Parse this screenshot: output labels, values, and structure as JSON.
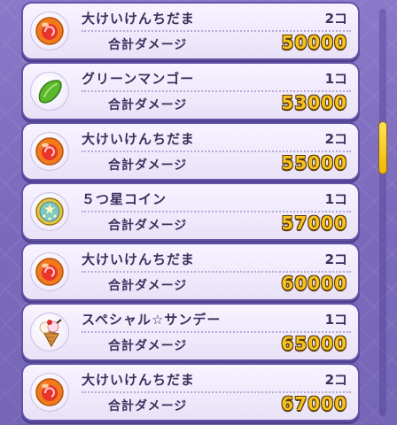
{
  "list": {
    "rows": [
      {
        "name": "大けいけんちだま",
        "qty": "2コ",
        "damage_label": "合計ダメージ",
        "damage": "50000",
        "icon": "exp-orb-icon"
      },
      {
        "name": "グリーンマンゴー",
        "qty": "1コ",
        "damage_label": "合計ダメージ",
        "damage": "53000",
        "icon": "green-mango-icon"
      },
      {
        "name": "大けいけんちだま",
        "qty": "2コ",
        "damage_label": "合計ダメージ",
        "damage": "55000",
        "icon": "exp-orb-icon"
      },
      {
        "name": "５つ星コイン",
        "qty": "1コ",
        "damage_label": "合計ダメージ",
        "damage": "57000",
        "icon": "five-star-coin-icon"
      },
      {
        "name": "大けいけんちだま",
        "qty": "2コ",
        "damage_label": "合計ダメージ",
        "damage": "60000",
        "icon": "exp-orb-icon"
      },
      {
        "name": "スペシャル☆サンデー",
        "qty": "1コ",
        "damage_label": "合計ダメージ",
        "damage": "65000",
        "icon": "special-sundae-icon"
      },
      {
        "name": "大けいけんちだま",
        "qty": "2コ",
        "damage_label": "合計ダメージ",
        "damage": "67000",
        "icon": "exp-orb-icon"
      }
    ]
  },
  "colors": {
    "background": "#7c6bbd",
    "card": "#f3effc",
    "damage_value": "#f5c21f",
    "text": "#3b2f5c",
    "scroll_thumb": "#f7c815"
  }
}
